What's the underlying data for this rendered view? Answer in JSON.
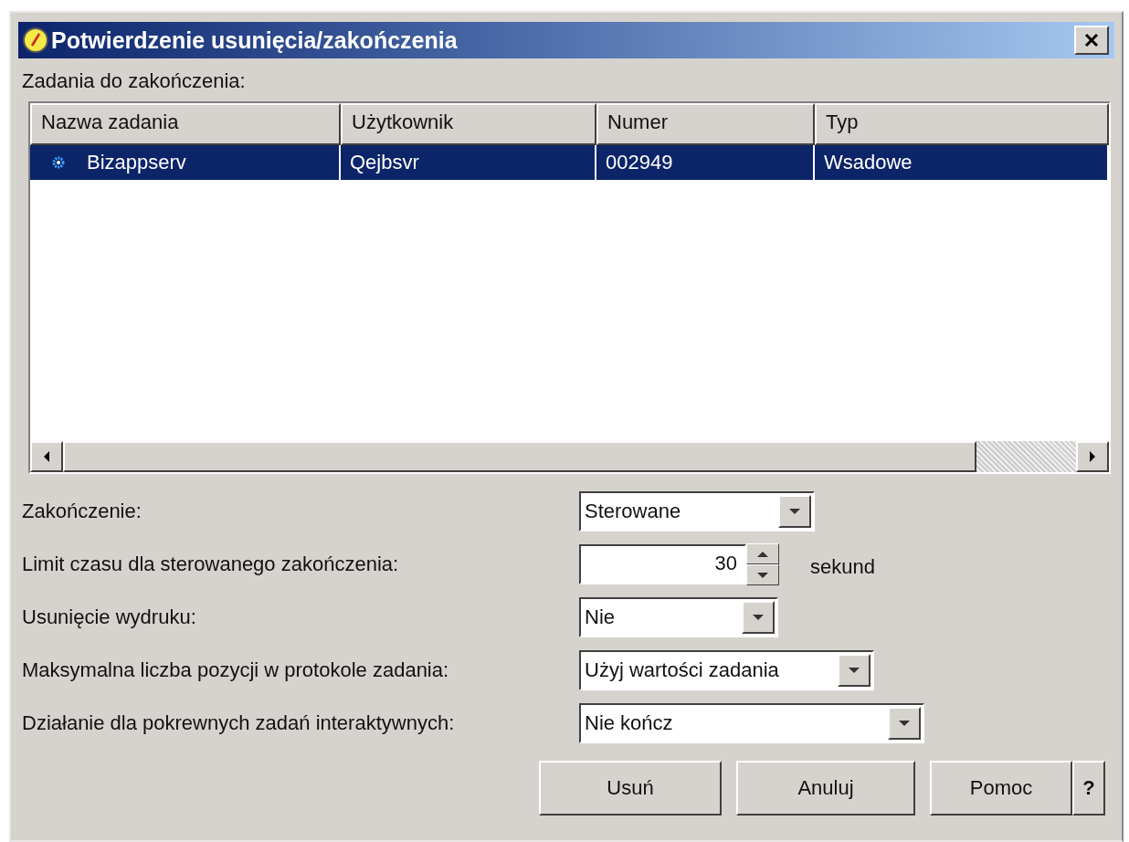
{
  "window": {
    "title": "Potwierdzenie usunięcia/zakończenia"
  },
  "list_label": "Zadania do zakończenia:",
  "table": {
    "columns": [
      "Nazwa zadania",
      "Użytkownik",
      "Numer",
      "Typ"
    ],
    "rows": [
      {
        "selected": true,
        "cells": [
          "Bizappserv",
          "Qejbsvr",
          "002949",
          "Wsadowe"
        ]
      }
    ]
  },
  "fields": [
    {
      "kind": "dropdown",
      "label": "Zakończenie:",
      "value": "Sterowane"
    },
    {
      "kind": "spinner",
      "label": "Limit czasu dla sterowanego zakończenia:",
      "value": "30",
      "unit": "sekund"
    },
    {
      "kind": "dropdown",
      "label": "Usunięcie wydruku:",
      "value": "Nie"
    },
    {
      "kind": "dropdown",
      "label": "Maksymalna liczba pozycji w protokole zadania:",
      "value": "Użyj wartości zadania"
    },
    {
      "kind": "dropdown",
      "label": "Działanie dla pokrewnych zadań interaktywnych:",
      "value": "Nie kończ"
    }
  ],
  "buttons": [
    "Usuń",
    "Anuluj",
    "Pomoc",
    "?"
  ]
}
